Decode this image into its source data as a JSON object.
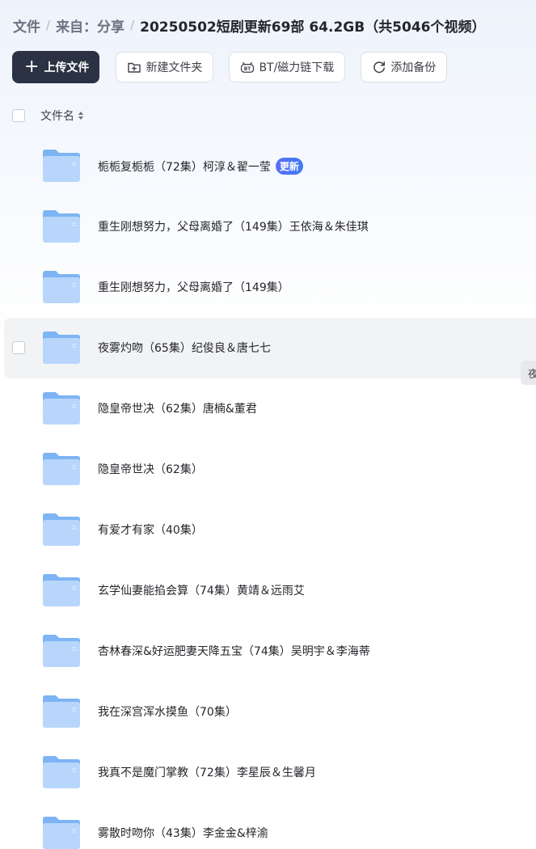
{
  "breadcrumb": {
    "root": "文件",
    "source": "来自：分享",
    "current": "20250502短剧更新69部 64.2GB（共5046个视频）",
    "separator": "/"
  },
  "toolbar": {
    "upload_label": "上传文件",
    "new_folder_label": "新建文件夹",
    "bt_label": "BT/磁力链下载",
    "backup_label": "添加备份"
  },
  "list": {
    "column_name": "文件名",
    "rows": [
      {
        "name": "栀栀复栀栀（72集）柯淳＆翟一莹",
        "badge": "更新"
      },
      {
        "name": "重生刚想努力，父母离婚了（149集）王依海＆朱佳琪"
      },
      {
        "name": "重生刚想努力，父母离婚了（149集）"
      },
      {
        "name": "夜雾灼吻（65集）纪俊良＆唐七七"
      },
      {
        "name": "隐皇帝世决（62集）唐楠&董君"
      },
      {
        "name": "隐皇帝世决（62集）"
      },
      {
        "name": "有爱才有家（40集）"
      },
      {
        "name": "玄学仙妻能掐会算（74集）黄靖＆远雨艾"
      },
      {
        "name": "杏林春深&好运肥妻天降五宝（74集）吴明宇＆李海蒂"
      },
      {
        "name": "我在深宫浑水摸鱼（70集）"
      },
      {
        "name": "我真不是魔门掌教（72集）李星辰＆生馨月"
      },
      {
        "name": "雾散时吻你（43集）李金金&梓渝"
      }
    ]
  },
  "tooltip": "夜",
  "colors": {
    "primary": "#2b3244",
    "badge": "#4a75f5",
    "folder_light": "#bcd8fb",
    "folder_dark": "#7db4f4"
  },
  "icons": {
    "upload": "plus-icon",
    "new_folder": "folder-plus-icon",
    "bt": "bt-download-icon",
    "backup": "sync-icon",
    "sort": "sort-icon",
    "folder": "folder-icon"
  }
}
